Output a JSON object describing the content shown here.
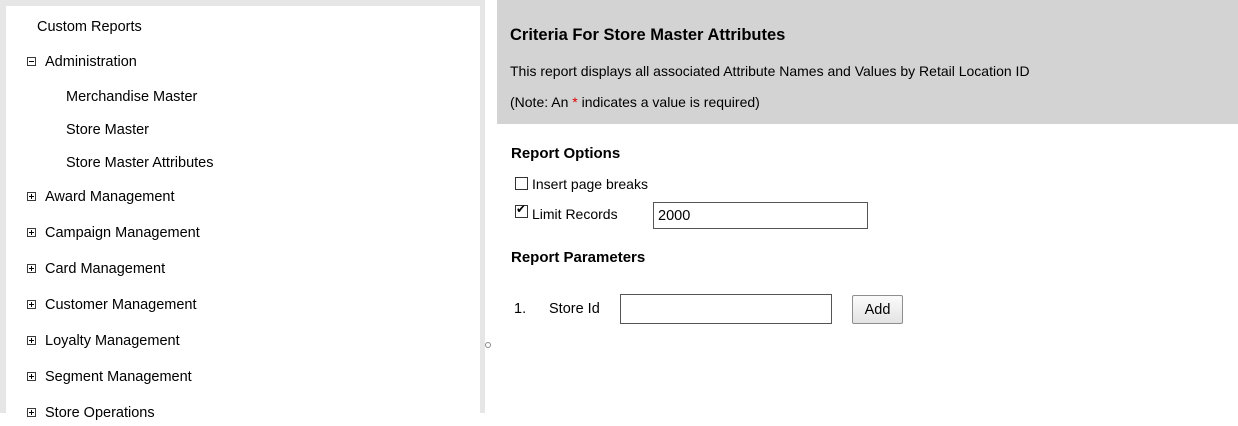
{
  "nav": {
    "items": [
      {
        "label": "Custom Reports",
        "toggle": "none",
        "level": 0
      },
      {
        "label": "Administration",
        "toggle": "minus",
        "level": 0
      },
      {
        "label": "Merchandise Master",
        "toggle": "none",
        "level": 1
      },
      {
        "label": "Store Master",
        "toggle": "none",
        "level": 1
      },
      {
        "label": "Store Master Attributes",
        "toggle": "none",
        "level": 1
      },
      {
        "label": "Award Management",
        "toggle": "plus",
        "level": 0
      },
      {
        "label": "Campaign Management",
        "toggle": "plus",
        "level": 0
      },
      {
        "label": "Card Management",
        "toggle": "plus",
        "level": 0
      },
      {
        "label": "Customer Management",
        "toggle": "plus",
        "level": 0
      },
      {
        "label": "Loyalty Management",
        "toggle": "plus",
        "level": 0
      },
      {
        "label": "Segment Management",
        "toggle": "plus",
        "level": 0
      },
      {
        "label": "Store Operations",
        "toggle": "plus",
        "level": 0
      }
    ]
  },
  "header": {
    "title": "Criteria For Store Master Attributes",
    "description": "This report displays all associated Attribute Names and Values by Retail Location ID",
    "note_prefix": "(Note: An ",
    "note_star": "*",
    "note_suffix": " indicates a value is required)"
  },
  "report_options": {
    "title": "Report Options",
    "insert_page_breaks": {
      "label": "Insert page breaks",
      "checked": false
    },
    "limit_records": {
      "label": "Limit Records",
      "checked": true,
      "value": "2000"
    }
  },
  "report_parameters": {
    "title": "Report Parameters",
    "params": [
      {
        "number": "1.",
        "label": "Store Id",
        "value": ""
      }
    ],
    "add_label": "Add"
  },
  "colors": {
    "header_bg": "#d3d3d3",
    "required_star": "#e00000",
    "nav_border": "#e6e6e6"
  }
}
